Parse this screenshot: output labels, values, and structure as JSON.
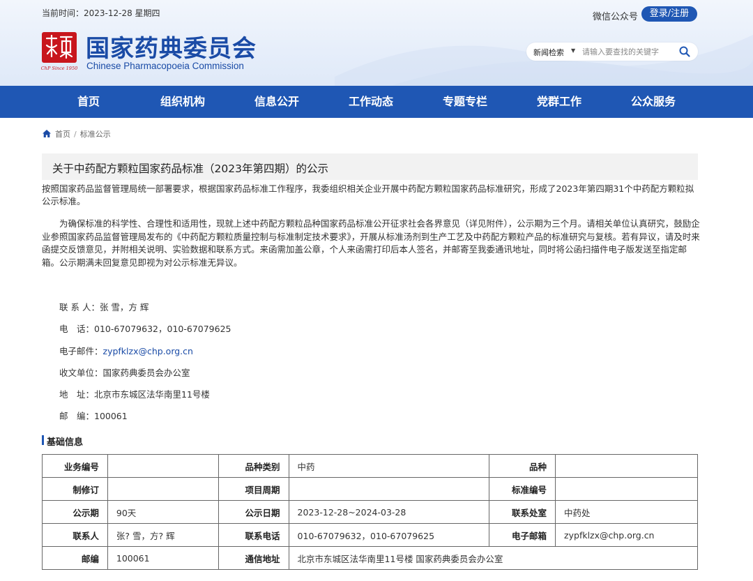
{
  "header": {
    "date_text": "当前时间：2023-12-28 星期四",
    "wechat_label": "微信公众号",
    "login_label": "登录/注册",
    "logo": {
      "title_cn": "国家药典委员会",
      "title_en": "Chinese Pharmacopoeia Commission",
      "seal_text": "ChP Since 1950"
    },
    "search": {
      "type_label": "新闻检索",
      "placeholder": "请输入要查找的关键字"
    }
  },
  "nav": {
    "items": [
      "首页",
      "组织机构",
      "信息公开",
      "工作动态",
      "专题专栏",
      "党群工作",
      "公众服务"
    ]
  },
  "breadcrumb": {
    "home": "首页",
    "current": "标准公示"
  },
  "article": {
    "title": "关于中药配方颗粒国家药品标准（2023年第四期）的公示",
    "para1": "按照国家药品监督管理局统一部署要求，根据国家药品标准工作程序，我委组织相关企业开展中药配方颗粒国家药品标准研究，形成了2023年第四期31个中药配方颗粒拟公示标准。",
    "para2": "为确保标准的科学性、合理性和适用性，现就上述中药配方颗粒品种国家药品标准公开征求社会各界意见（详见附件），公示期为三个月。请相关单位认真研究，鼓励企业参照国家药品监督管理局发布的《中药配方颗粒质量控制与标准制定技术要求》，开展从标准汤剂到生产工艺及中药配方颗粒产品的标准研究与复核。若有异议，请及时来函提交反馈意见，并附相关说明、实验数据和联系方式。来函需加盖公章，个人来函需打印后本人签名，并邮寄至我委通讯地址，同时将公函扫描件电子版发送至指定邮箱。公示期满未回复意见即视为对公示标准无异议。",
    "contacts": {
      "person": "联 系 人：张 雪，方 辉",
      "phone": "电　话：010-67079632，010-67079625",
      "email_label": "电子邮件：",
      "email": "zypfklzx@chp.org.cn",
      "unit": "收文单位：国家药典委员会办公室",
      "address": "地　址：北京市东城区法华南里11号楼",
      "postcode": "邮　编：100061"
    }
  },
  "basic_info": {
    "heading": "基础信息",
    "rows": [
      [
        "业务编号",
        "",
        "品种类别",
        "中药",
        "品种",
        ""
      ],
      [
        "制修订",
        "",
        "项目周期",
        "",
        "标准编号",
        ""
      ],
      [
        "公示期",
        "90天",
        "公示日期",
        "2023-12-28~2024-03-28",
        "联系处室",
        "中药处"
      ],
      [
        "联系人",
        "张?  雪，方?  辉",
        "联系电话",
        "010-67079632，010-67079625",
        "电子邮箱",
        "zypfklzx@chp.org.cn"
      ],
      [
        "邮编",
        "100061",
        "通信地址",
        "北京市东城区法华南里11号楼 国家药典委员会办公室",
        "",
        ""
      ]
    ]
  },
  "colors": {
    "brand_blue": "#1f57b4",
    "logo_red": "#c8161d",
    "title_bg": "#f2f2f2"
  },
  "icons": {
    "search": "search-icon",
    "home": "home-icon",
    "dropdown": "chevron-down-icon",
    "logo": "seal-logo-icon"
  }
}
